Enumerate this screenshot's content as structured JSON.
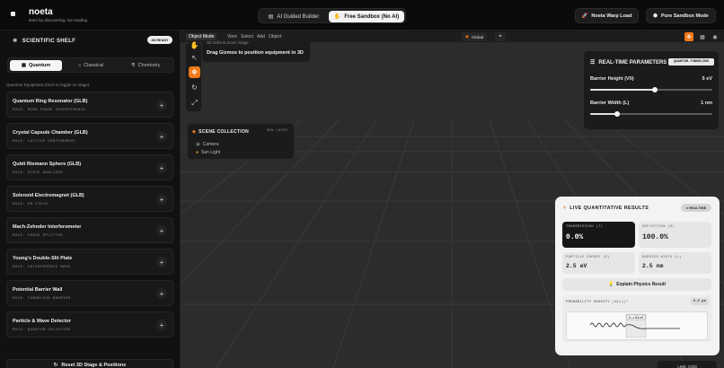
{
  "app": {
    "brand": "noeta",
    "tagline": "learn by discovering, not reading"
  },
  "modes": {
    "ai_label": "AI Guided Builder",
    "free_label": "Free Sandbox (No AI)"
  },
  "topbar": {
    "warp_label": "Noeta Warp Load",
    "sandbox_label": "Pure Sandbox Mode"
  },
  "sidebar": {
    "title": "SCIENTIFIC SHELF",
    "status": "3D READY",
    "tabs": [
      "Quantum",
      "Classical",
      "Chemistry"
    ],
    "hint": "Quantum Equipment (Click to toggle on stage):",
    "items": [
      {
        "name": "Quantum Ring Resonator (GLB)",
        "role": "ROLE: RING PHASE INTERFERENCE"
      },
      {
        "name": "Crystal Capsule Chamber (GLB)",
        "role": "ROLE: LATTICE CONFINEMENT"
      },
      {
        "name": "Qubit Riemann Sphere (GLB)",
        "role": "ROLE: STATE ANALYZER"
      },
      {
        "name": "Solenoid Electromagnet (GLB)",
        "role": "ROLE: EM FIELD"
      },
      {
        "name": "Mach-Zehnder Interferometer",
        "role": "ROLE: PHASE SPLITTER"
      },
      {
        "name": "Young's Double-Slit Plate",
        "role": "ROLE: INTERFERENCE MASK"
      },
      {
        "name": "Potential Barrier Wall",
        "role": "ROLE: TUNNELING BARRIER"
      },
      {
        "name": "Particle & Wave Detector",
        "role": "ROLE: QUANTUM COLLECTOR"
      }
    ],
    "reset_label": "Reset 3D Stage & Positions"
  },
  "viewport": {
    "menu": [
      "Object Mode",
      "View",
      "Select",
      "Add",
      "Object"
    ],
    "global_label": "Global",
    "hint_sub": "3D Orbit & Zoom Stage",
    "hint_main": "Drag Gizmos to position equipment in 3D",
    "scene_title": "SCENE COLLECTION",
    "scene_action": "NEW LAYER",
    "scene_items": [
      "Camera",
      "Sun Light"
    ],
    "corner_label": "LMB: Orbit"
  },
  "params": {
    "title": "REAL-TIME PARAMETERS",
    "chip": "QUANTUM-TUNNELING",
    "height_label": "Barrier Height (V0)",
    "height_value": "5 eV",
    "height_level": 0.53,
    "width_label": "Barrier Width (L)",
    "width_value": "1 nm",
    "width_level": 0.22
  },
  "results": {
    "title": "LIVE QUANTITATIVE RESULTS",
    "badge": "REALTIME",
    "transmission_label": "TRANSMISSION (T)",
    "transmission_value": "0.0%",
    "reflection_label": "REFLECTION (R)",
    "reflection_value": "100.0%",
    "energy_label": "PARTICLE ENERGY (E)",
    "energy_value": "2.5 eV",
    "width_label": "BARRIER WIDTH (L)",
    "width_value": "2.5 nm",
    "explain_label": "Explain Physics Result",
    "density_label": "PROBABILITY DENSITY |Ψ(x)|²",
    "density_value": "4.2 ps",
    "density_marker": "V₀ = 5.0 eV"
  },
  "colors": {
    "accent": "#f07a1a",
    "scene_camera": "#7a7a7a",
    "scene_light": "#f0a030"
  }
}
